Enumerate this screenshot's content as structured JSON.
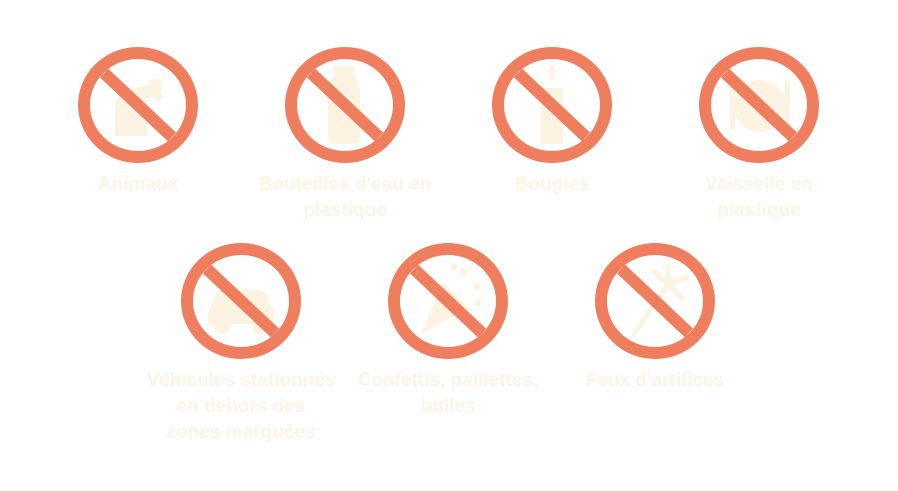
{
  "colors": {
    "sign_red": "#ef7e5e",
    "pictogram_cream": "#fdf3e3",
    "label_text": "#fdf4e6",
    "background": "#ffffff"
  },
  "items": [
    {
      "icon": "animal-icon",
      "label": "Animaux"
    },
    {
      "icon": "plastic-bottle-icon",
      "label": "Bouteilles d'eau en\nplastique"
    },
    {
      "icon": "candle-icon",
      "label": "Bougies"
    },
    {
      "icon": "plastic-tableware-icon",
      "label": "Vaisselle en\nplastique"
    },
    {
      "icon": "motorized-vehicle-icon",
      "label": "Véhicules stationnés\nen dehors des\nzones marquées"
    },
    {
      "icon": "confetti-icon",
      "label": "Confettis, paillettes,\nbulles"
    },
    {
      "icon": "fireworks-icon",
      "label": "Feux d'artifices"
    }
  ]
}
